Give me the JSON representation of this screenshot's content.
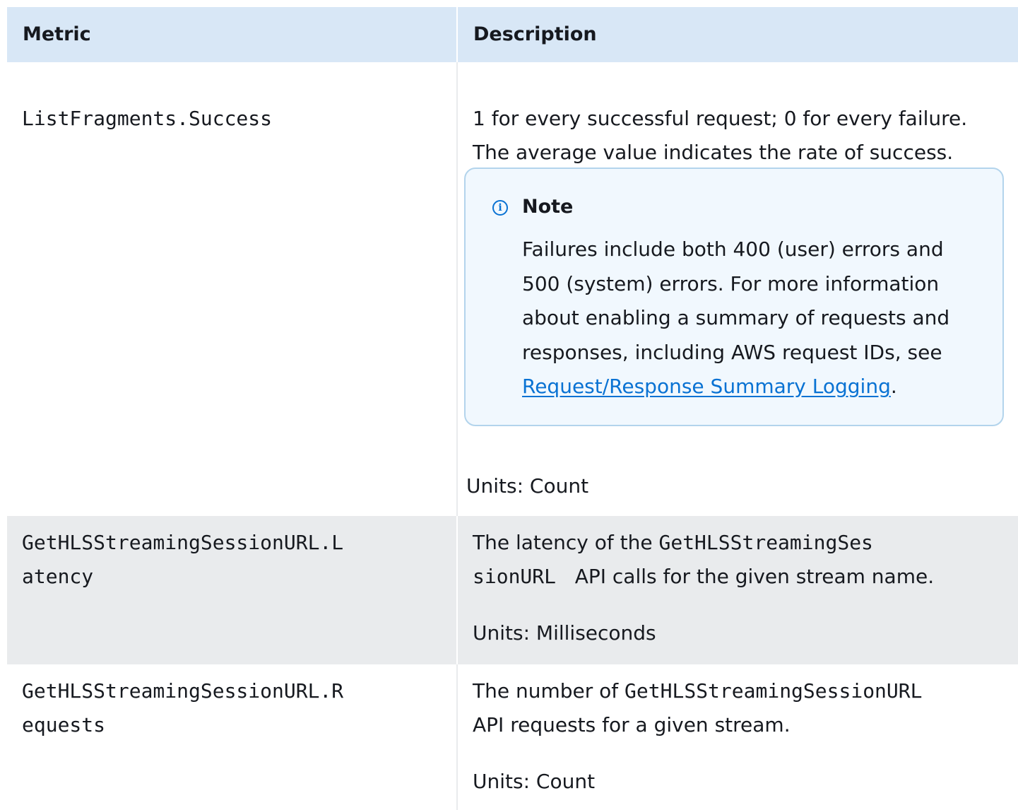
{
  "header": {
    "metric": "Metric",
    "description": "Description"
  },
  "rows": [
    {
      "metric_line1": "ListFragments.Success",
      "desc_line1": "1 for every successful request; 0 for every failure.",
      "desc_line2": "The average value indicates the rate of success.",
      "note": {
        "title": "Note",
        "line1": "Failures include both 400 (user) errors and",
        "line2": "500 (system) errors. For more information",
        "line3": "about enabling a summary of requests and",
        "line4": "responses, including AWS request IDs, see",
        "link": "Request/Response Summary Logging",
        "after_link": "."
      },
      "units": "Units: Count"
    },
    {
      "metric_line1": "GetHLSStreamingSessionURL.L",
      "metric_line2": "atency",
      "desc_pre": "The latency of the ",
      "desc_code1": "GetHLSStreamingSes",
      "desc_code2": "sionURL",
      "desc_post": "   API calls for the given stream name.",
      "units": "Units: Milliseconds"
    },
    {
      "metric_line1": "GetHLSStreamingSessionURL.R",
      "metric_line2": "equests",
      "desc_pre": "The number of ",
      "desc_code": "GetHLSStreamingSessionURL",
      "desc_line2": "API requests for a given stream.",
      "units": "Units: Count"
    }
  ]
}
